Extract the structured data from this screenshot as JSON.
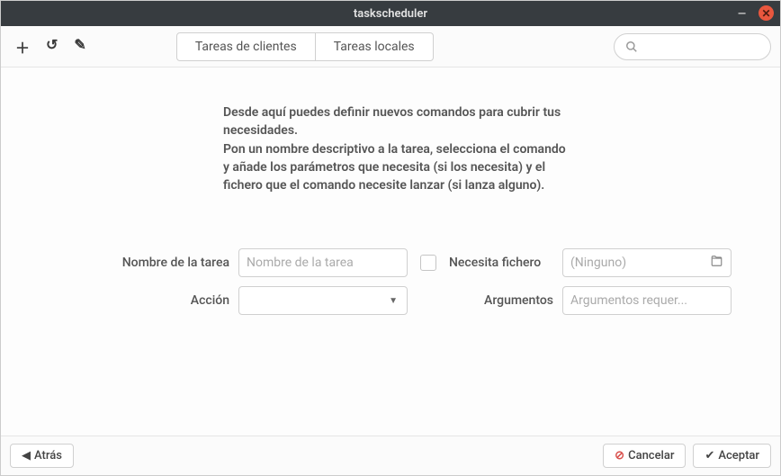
{
  "window": {
    "title": "taskscheduler"
  },
  "tabs": {
    "clients": "Tareas de clientes",
    "local": "Tareas locales"
  },
  "description": "Desde aquí puedes definir nuevos comandos para cubrir tus necesidades.\nPon un nombre descriptivo a la tarea, selecciona el comando y añade los parámetros que necesita (si los necesita) y el fichero que el comando necesite lanzar (si lanza alguno).",
  "form": {
    "task_name_label": "Nombre de la tarea",
    "task_name_placeholder": "Nombre de la tarea",
    "action_label": "Acción",
    "needs_file_label": "Necesita fichero",
    "file_placeholder": "(Ninguno)",
    "arguments_label": "Argumentos",
    "arguments_placeholder": "Argumentos requer..."
  },
  "buttons": {
    "back": "Atrás",
    "cancel": "Cancelar",
    "accept": "Aceptar"
  }
}
